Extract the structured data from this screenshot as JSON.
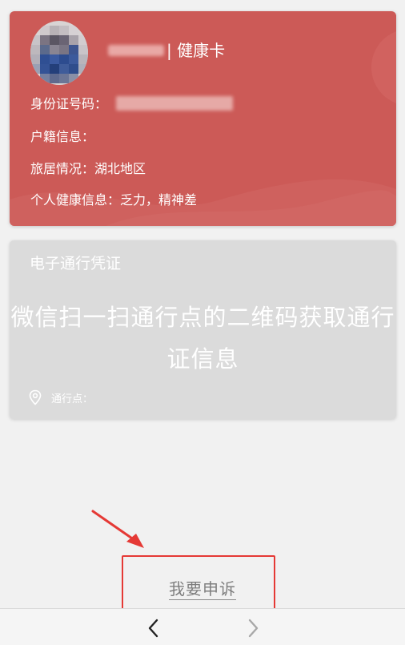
{
  "health_card": {
    "title": "| 健康卡",
    "id_label": "身份证号码：",
    "household_label": "户籍信息：",
    "travel_label": "旅居情况：湖北地区",
    "health_label": "个人健康信息：乏力，精神差",
    "background_color": "#cc5a57"
  },
  "pass_card": {
    "title": "电子通行凭证",
    "message": "微信扫一扫通行点的二维码获取通行证信息",
    "point_label": "通行点：",
    "pin_icon": "location-pin-icon",
    "background_color": "#dbdbdb"
  },
  "appeal": {
    "label": "我要申诉",
    "highlight_color": "#e53935"
  },
  "bottom_nav": {
    "back_icon": "chevron-left-icon",
    "forward_icon": "chevron-right-icon"
  }
}
